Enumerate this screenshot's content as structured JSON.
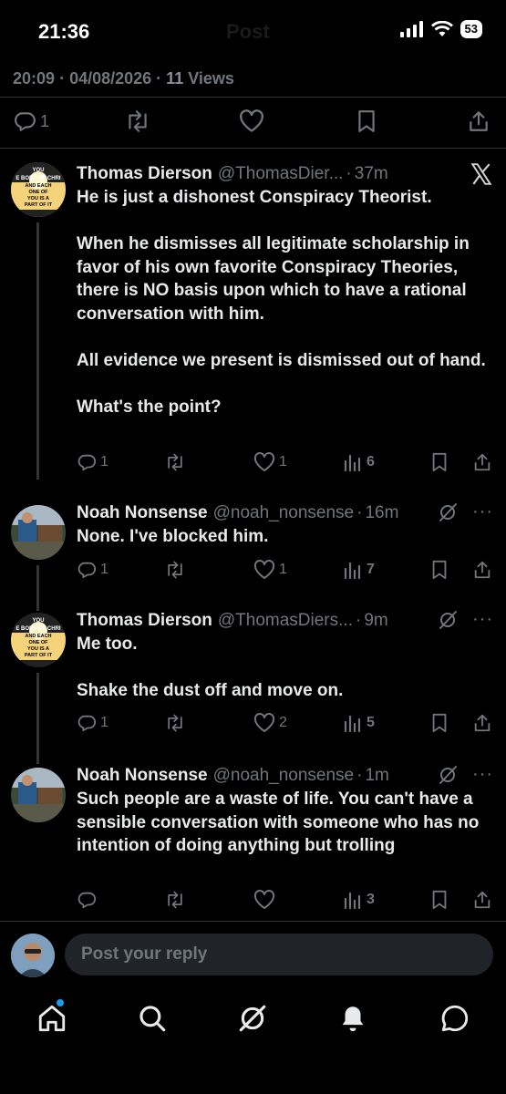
{
  "status_bar": {
    "time": "21:36",
    "ghost_title": "Post",
    "battery": "53"
  },
  "post_meta": {
    "time": "20:09",
    "date": "04/08/2026",
    "views_count": "11",
    "views_label": "Views"
  },
  "main_actions": {
    "reply_count": "1"
  },
  "tweets": [
    {
      "name": "Thomas Dierson",
      "handle": "@ThomasDier...",
      "age": "37m",
      "text": "He is just a dishonest Conspiracy Theorist.\n\nWhen he dismisses all legitimate scholarship in favor of his own favorite Conspiracy Theories, there is NO basis upon which to have a rational conversation with him.\n\nAll evidence we present is dismissed out of hand.\n\nWhat's the point?",
      "replies": "1",
      "likes": "1",
      "views": "6"
    },
    {
      "name": "Noah Nonsense",
      "handle": "@noah_nonsense",
      "age": "16m",
      "text": "None.  I've blocked him.",
      "replies": "1",
      "likes": "1",
      "views": "7"
    },
    {
      "name": "Thomas Dierson",
      "handle": "@ThomasDiers...",
      "age": "9m",
      "text": "Me too.\n\nShake the dust off and move on.",
      "replies": "1",
      "likes": "2",
      "views": "5"
    },
    {
      "name": "Noah Nonsense",
      "handle": "@noah_nonsense",
      "age": "1m",
      "text": "Such people are a waste of life.  You can't have a sensible conversation with someone who has no intention of doing anything but trolling",
      "replies": "",
      "likes": "",
      "views": "3"
    }
  ],
  "avatar_text": {
    "lines": [
      "YOU",
      "E BODY OF CHRI",
      "AND EACH",
      "ONE OF",
      "YOU IS A",
      "PART OF IT"
    ]
  },
  "reply_box": {
    "placeholder": "Post your reply"
  },
  "icons": {
    "x_logo": "x-logo-icon",
    "grok": "grok-icon",
    "more": "more-icon",
    "reply": "reply-icon",
    "repost": "repost-icon",
    "like": "like-icon",
    "views": "views-icon",
    "bookmark": "bookmark-icon",
    "share": "share-icon",
    "home": "home-icon",
    "search": "search-icon",
    "notifications": "bell-icon",
    "messages": "messages-icon"
  },
  "colors": {
    "accent": "#1d9bf0",
    "muted": "#71767b",
    "text": "#e7e9ea",
    "background": "#000000"
  }
}
